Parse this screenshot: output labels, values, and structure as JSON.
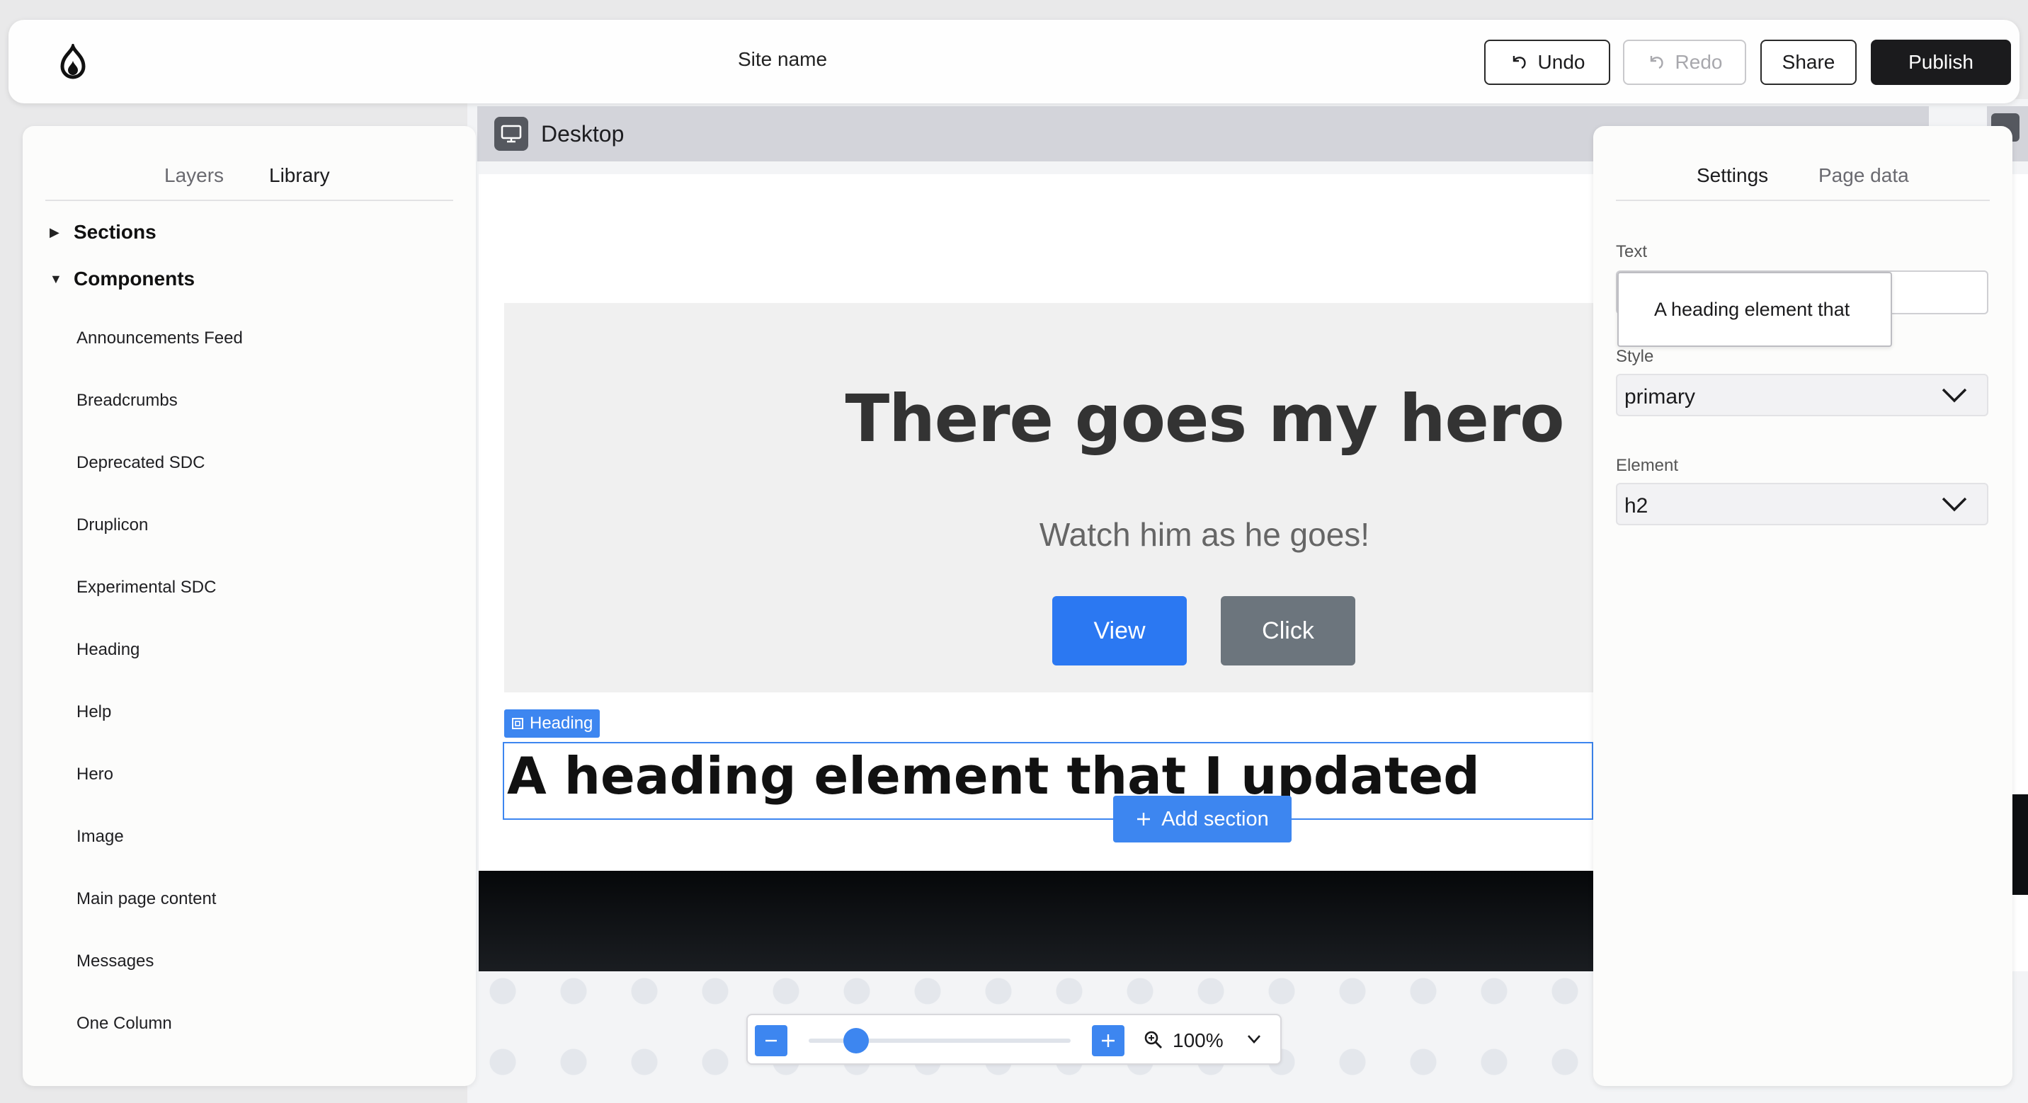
{
  "topbar": {
    "site_name": "Site name",
    "undo_label": "Undo",
    "redo_label": "Redo",
    "share_label": "Share",
    "publish_label": "Publish"
  },
  "viewport": {
    "label": "Desktop"
  },
  "hero": {
    "title": "There goes my hero",
    "subtitle": "Watch him as he goes!",
    "primary_button": "View",
    "secondary_button": "Click"
  },
  "selected_component": {
    "tag_label": "Heading",
    "text": "A heading element that I updated"
  },
  "add_section_label": "Add section",
  "left_panel": {
    "tabs": [
      "Layers",
      "Library"
    ],
    "active_tab": "Library",
    "groups": [
      {
        "label": "Sections",
        "expanded": false
      },
      {
        "label": "Components",
        "expanded": true
      }
    ],
    "components": [
      "Announcements Feed",
      "Breadcrumbs",
      "Deprecated SDC",
      "Druplicon",
      "Experimental SDC",
      "Heading",
      "Help",
      "Hero",
      "Image",
      "Main page content",
      "Messages",
      "One Column"
    ]
  },
  "right_panel": {
    "tabs": [
      "Settings",
      "Page data"
    ],
    "active_tab": "Settings",
    "text_label": "Text",
    "text_value": "A heading element that",
    "style_label": "Style",
    "style_value": "primary",
    "element_label": "Element",
    "element_value": "h2"
  },
  "zoom": {
    "value": "100%",
    "level_fraction": 0.18
  },
  "colors": {
    "accent": "#3d86f0",
    "primary_button": "#2b78f2",
    "secondary_button": "#6c757d",
    "publish": "#1b1b1d"
  },
  "icons": [
    "drupal-logo-icon",
    "undo-icon",
    "redo-icon",
    "desktop-icon",
    "component-icon",
    "plus-icon",
    "minus-icon",
    "zoom-icon",
    "chevron-down-icon"
  ]
}
